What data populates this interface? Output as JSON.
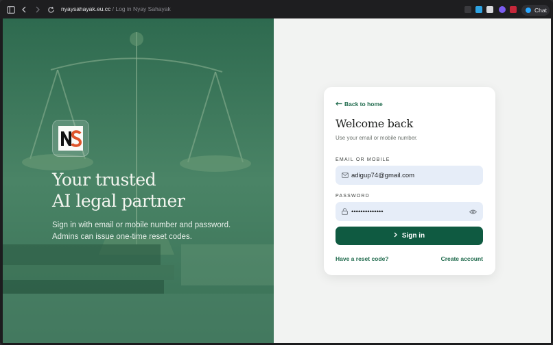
{
  "browser": {
    "url_domain": "nyaysahayak.eu.cc",
    "url_separator": "/",
    "page_title": "Log in Nyay Sahayak",
    "chat_label": "Chat"
  },
  "hero": {
    "logo_text": "NS",
    "heading_line1": "Your trusted",
    "heading_line2": "AI legal partner",
    "paragraph_line1": "Sign in with email or mobile number and password.",
    "paragraph_line2": "Admins can issue one-time reset codes."
  },
  "card": {
    "back_label": "Back to home",
    "title": "Welcome back",
    "subtitle": "Use your email or mobile number.",
    "email_label": "EMAIL OR MOBILE",
    "email_value": "adigup74@gmail.com",
    "password_label": "PASSWORD",
    "password_value": "••••••••••••••",
    "signin_label": "Sign in",
    "reset_link": "Have a reset code?",
    "create_link": "Create account"
  },
  "colors": {
    "brand_green": "#0f5a41",
    "hero_green": "#3f7a5e",
    "input_bg": "#e6edf8"
  },
  "icons": [
    "sidebar-icon",
    "back-arrow-icon",
    "forward-arrow-icon",
    "reload-icon",
    "mail-icon",
    "lock-icon",
    "eye-icon",
    "chevron-right-icon"
  ]
}
